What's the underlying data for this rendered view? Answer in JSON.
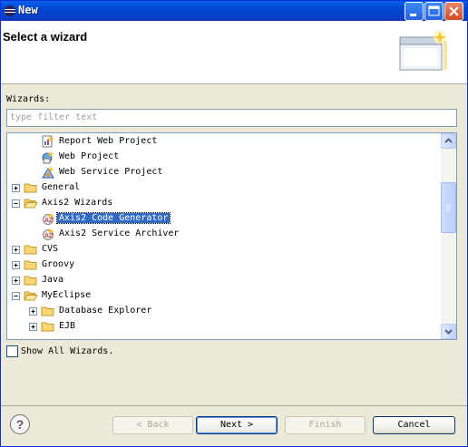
{
  "window": {
    "title": "New"
  },
  "header": {
    "title": "Select a wizard"
  },
  "wizards_label": "Wizards:",
  "filter": {
    "placeholder": "type filter text",
    "value": ""
  },
  "tree": {
    "items": [
      {
        "label": "Report Web Project",
        "icon": "report-project-icon",
        "level": 1,
        "expandable": false,
        "expanded": false,
        "selected": false
      },
      {
        "label": "Web Project",
        "icon": "web-project-icon",
        "level": 1,
        "expandable": false,
        "expanded": false,
        "selected": false
      },
      {
        "label": "Web Service Project",
        "icon": "web-service-icon",
        "level": 1,
        "expandable": false,
        "expanded": false,
        "selected": false
      },
      {
        "label": "General",
        "icon": "folder-icon",
        "level": 0,
        "expandable": true,
        "expanded": false,
        "selected": false
      },
      {
        "label": "Axis2 Wizards",
        "icon": "folder-open-icon",
        "level": 0,
        "expandable": true,
        "expanded": true,
        "selected": false
      },
      {
        "label": "Axis2 Code Generator",
        "icon": "axis2-wizard-icon",
        "level": 1,
        "expandable": false,
        "expanded": false,
        "selected": true
      },
      {
        "label": "Axis2 Service Archiver",
        "icon": "axis2-wizard-icon",
        "level": 1,
        "expandable": false,
        "expanded": false,
        "selected": false
      },
      {
        "label": "CVS",
        "icon": "folder-icon",
        "level": 0,
        "expandable": true,
        "expanded": false,
        "selected": false
      },
      {
        "label": "Groovy",
        "icon": "folder-icon",
        "level": 0,
        "expandable": true,
        "expanded": false,
        "selected": false
      },
      {
        "label": "Java",
        "icon": "folder-icon",
        "level": 0,
        "expandable": true,
        "expanded": false,
        "selected": false
      },
      {
        "label": "MyEclipse",
        "icon": "folder-open-icon",
        "level": 0,
        "expandable": true,
        "expanded": true,
        "selected": false
      },
      {
        "label": "Database Explorer",
        "icon": "folder-icon",
        "level": 1,
        "expandable": true,
        "expanded": false,
        "selected": false
      },
      {
        "label": "EJB",
        "icon": "folder-icon",
        "level": 1,
        "expandable": true,
        "expanded": false,
        "selected": false
      }
    ]
  },
  "show_all": {
    "label": "Show All Wizards.",
    "checked": false
  },
  "buttons": {
    "help": "?",
    "back": "< Back",
    "next": "Next >",
    "finish": "Finish",
    "cancel": "Cancel"
  },
  "colors": {
    "selection": "#316ac5",
    "titlebar": "#0a5fe8",
    "dialog_bg": "#ece9d8"
  }
}
